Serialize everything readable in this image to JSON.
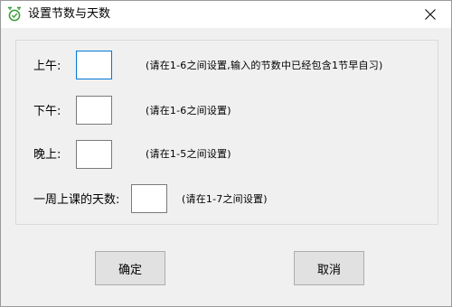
{
  "window": {
    "title": "设置节数与天数",
    "app_icon": "alarm-clock-icon",
    "close_icon": "close-icon"
  },
  "form": {
    "morning": {
      "label": "上午:",
      "value": "",
      "hint": "(请在1-6之间设置,输入的节数中已经包含1节早自习)"
    },
    "afternoon": {
      "label": "下午:",
      "value": "",
      "hint": "(请在1-6之间设置)"
    },
    "evening": {
      "label": "晚上:",
      "value": "",
      "hint": "(请在1-5之间设置)"
    },
    "days": {
      "label": "一周上课的天数:",
      "value": "",
      "hint": "(请在1-7之间设置)"
    }
  },
  "buttons": {
    "ok_label": "确定",
    "cancel_label": "取消"
  },
  "colors": {
    "focus_border": "#0078d7",
    "app_icon_green": "#3a9d3a"
  }
}
